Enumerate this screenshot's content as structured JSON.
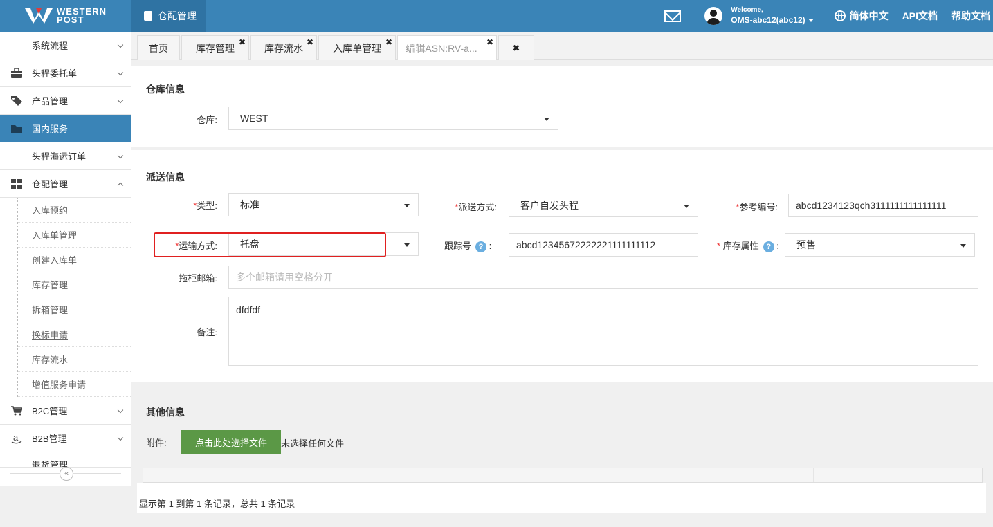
{
  "brand": {
    "line1": "WESTERN",
    "line2": "POST"
  },
  "header": {
    "module_label": "仓配管理",
    "welcome": "Welcome,",
    "username": "OMS-abc12(abc12)",
    "language": "简体中文",
    "api_docs": "API文档",
    "help_docs": "帮助文档"
  },
  "sidebar": {
    "items": [
      {
        "label": "系统流程",
        "icon": "none",
        "chevron": "down"
      },
      {
        "label": "头程委托单",
        "icon": "briefcase-icon",
        "chevron": "down"
      },
      {
        "label": "产品管理",
        "icon": "tag-icon",
        "chevron": "down"
      },
      {
        "label": "国内服务",
        "icon": "folder-icon",
        "active": true
      },
      {
        "label": "头程海运订单",
        "icon": "none",
        "chevron": "down"
      },
      {
        "label": "仓配管理",
        "icon": "grid-icon",
        "chevron": "up"
      }
    ],
    "sub_items": [
      "入库预约",
      "入库单管理",
      "创建入库单",
      "库存管理",
      "拆箱管理",
      "换标申请",
      "库存流水",
      "增值服务申请"
    ],
    "items_after": [
      {
        "label": "B2C管理",
        "icon": "cart-icon",
        "chevron": "down"
      },
      {
        "label": "B2B管理",
        "icon": "amazon-icon",
        "chevron": "down"
      },
      {
        "label": "退货管理",
        "icon": "none",
        "chevron": "down"
      }
    ],
    "collapse_glyph": "«"
  },
  "tabs": [
    {
      "label": "首页",
      "closable": false
    },
    {
      "label": "库存管理",
      "closable": true
    },
    {
      "label": "库存流水",
      "closable": true
    },
    {
      "label": "入库单管理",
      "closable": true
    },
    {
      "label": "编辑ASN:RV-a...",
      "closable": true,
      "active": true
    }
  ],
  "close_all": "✖",
  "warehouse_section": {
    "title": "仓库信息",
    "warehouse_label": "仓库:",
    "warehouse_value": "WEST"
  },
  "delivery_section": {
    "title": "派送信息",
    "type_label": "类型:",
    "type_value": "标准",
    "delivery_method_label": "派送方式:",
    "delivery_method_value": "客户自发头程",
    "reference_label": "参考编号:",
    "reference_value": "abcd1234123qch3111111111111111",
    "transport_label": "运输方式:",
    "transport_value": "托盘",
    "tracking_label": "跟踪号",
    "tracking_value": "abcd12345672222221111111112",
    "stock_attr_label": "库存属性",
    "stock_attr_value": "预售",
    "colon": ":",
    "required_mark": "*",
    "help_glyph": "?",
    "email_label": "拖柜邮箱:",
    "email_placeholder": "多个邮箱请用空格分开",
    "remark_label": "备注:",
    "remark_value": "dfdfdf"
  },
  "other_section": {
    "title": "其他信息",
    "attachment_label": "附件:",
    "upload_button": "点击此处选择文件",
    "file_status": "未选择任何文件",
    "pager_text": "显示第 1 到第 1 条记录，总共 1 条记录"
  },
  "colors": {
    "accent": "#3a84b7",
    "upload": "#5b9846",
    "highlight": "#e02020"
  }
}
